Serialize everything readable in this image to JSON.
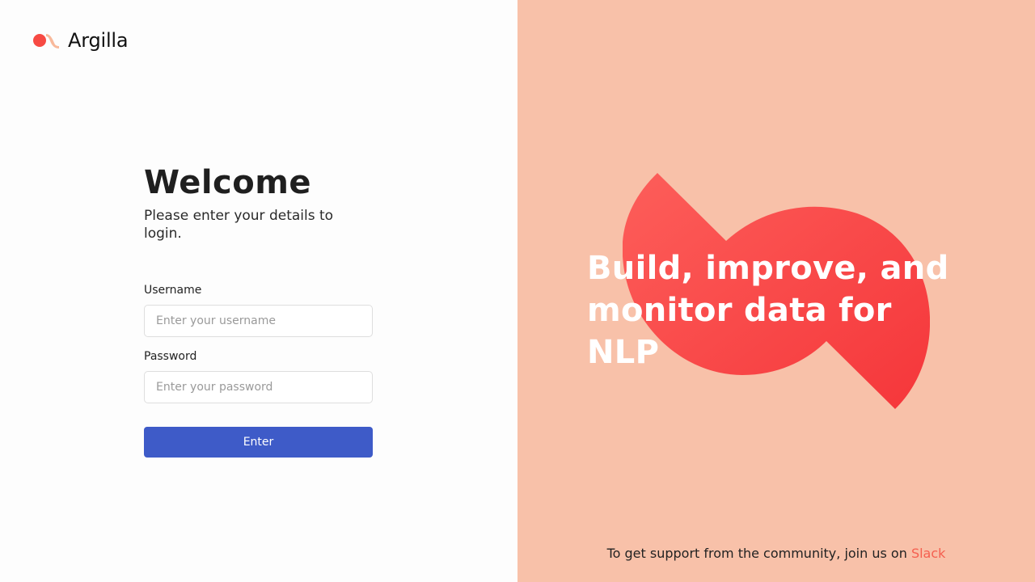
{
  "app": {
    "name": "Argilla",
    "logo_icon": "argilla-logo-icon"
  },
  "login": {
    "title": "Welcome",
    "subtitle": "Please enter your details to login.",
    "username_label": "Username",
    "username_placeholder": "Enter your username",
    "username_value": "",
    "password_label": "Password",
    "password_placeholder": "Enter your password",
    "password_value": "",
    "submit_label": "Enter"
  },
  "promo": {
    "tagline": "Build, improve, and monitor data for NLP",
    "support_text": "To get support from the community, join us on ",
    "support_link": "Slack"
  },
  "colors": {
    "primary_button": "#3e5bc8",
    "promo_background": "#f8c1a9",
    "brand_red": "#f53d3d",
    "link": "#f55f4f"
  }
}
